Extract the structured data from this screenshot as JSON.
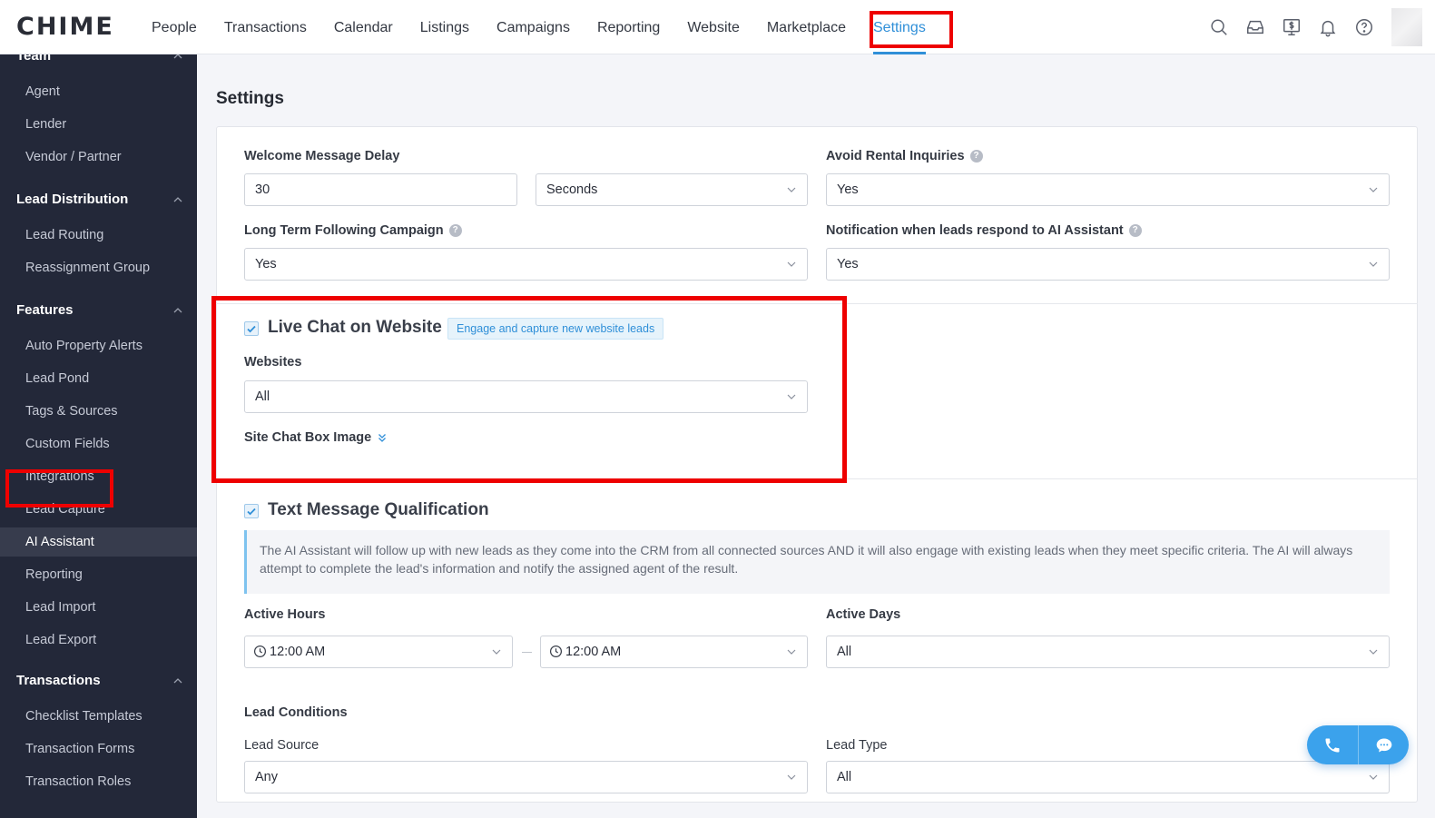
{
  "app": {
    "logo": "CHIME"
  },
  "nav": {
    "items": [
      {
        "label": "People"
      },
      {
        "label": "Transactions"
      },
      {
        "label": "Calendar"
      },
      {
        "label": "Listings"
      },
      {
        "label": "Campaigns"
      },
      {
        "label": "Reporting"
      },
      {
        "label": "Website"
      },
      {
        "label": "Marketplace"
      },
      {
        "label": "Settings",
        "active": true
      }
    ]
  },
  "sidebar": {
    "team": {
      "title": "Team",
      "items": [
        "Agent",
        "Lender",
        "Vendor / Partner"
      ]
    },
    "lead_distribution": {
      "title": "Lead Distribution",
      "items": [
        "Lead Routing",
        "Reassignment Group"
      ]
    },
    "features": {
      "title": "Features",
      "items": [
        "Auto Property Alerts",
        "Lead Pond",
        "Tags & Sources",
        "Custom Fields",
        "Integrations",
        "Lead Capture",
        "AI Assistant",
        "Reporting",
        "Lead Import",
        "Lead Export"
      ],
      "active": "AI Assistant"
    },
    "transactions": {
      "title": "Transactions",
      "items": [
        "Checklist Templates",
        "Transaction Forms",
        "Transaction Roles"
      ]
    }
  },
  "page": {
    "title": "Settings"
  },
  "general": {
    "welcome_delay": {
      "label": "Welcome Message Delay",
      "value": "30",
      "unit": "Seconds"
    },
    "avoid_rental": {
      "label": "Avoid Rental Inquiries",
      "value": "Yes"
    },
    "long_term": {
      "label": "Long Term Following Campaign",
      "value": "Yes"
    },
    "notification": {
      "label": "Notification when leads respond to AI Assistant",
      "value": "Yes"
    }
  },
  "live_chat": {
    "title": "Live Chat on Website",
    "checked": true,
    "tag": "Engage and capture new website leads",
    "websites": {
      "label": "Websites",
      "value": "All"
    },
    "chat_box_image": "Site Chat Box Image"
  },
  "text_qual": {
    "title": "Text Message Qualification",
    "checked": true,
    "info": "The AI Assistant will follow up with new leads as they come into the CRM from all connected sources AND it will also engage with existing leads when they meet specific criteria. The AI will always attempt to complete the lead's information and notify the assigned agent of the result.",
    "active_hours": {
      "label": "Active Hours",
      "from": "12:00 AM",
      "to": "12:00 AM"
    },
    "active_days": {
      "label": "Active Days",
      "value": "All"
    },
    "lead_conditions": "Lead Conditions",
    "lead_source": {
      "label": "Lead Source",
      "value": "Any"
    },
    "lead_type": {
      "label": "Lead Type",
      "value": "All"
    }
  },
  "colors": {
    "accent": "#2f8fd8",
    "sidebar_bg": "#232839",
    "highlight": "#ee0000"
  }
}
